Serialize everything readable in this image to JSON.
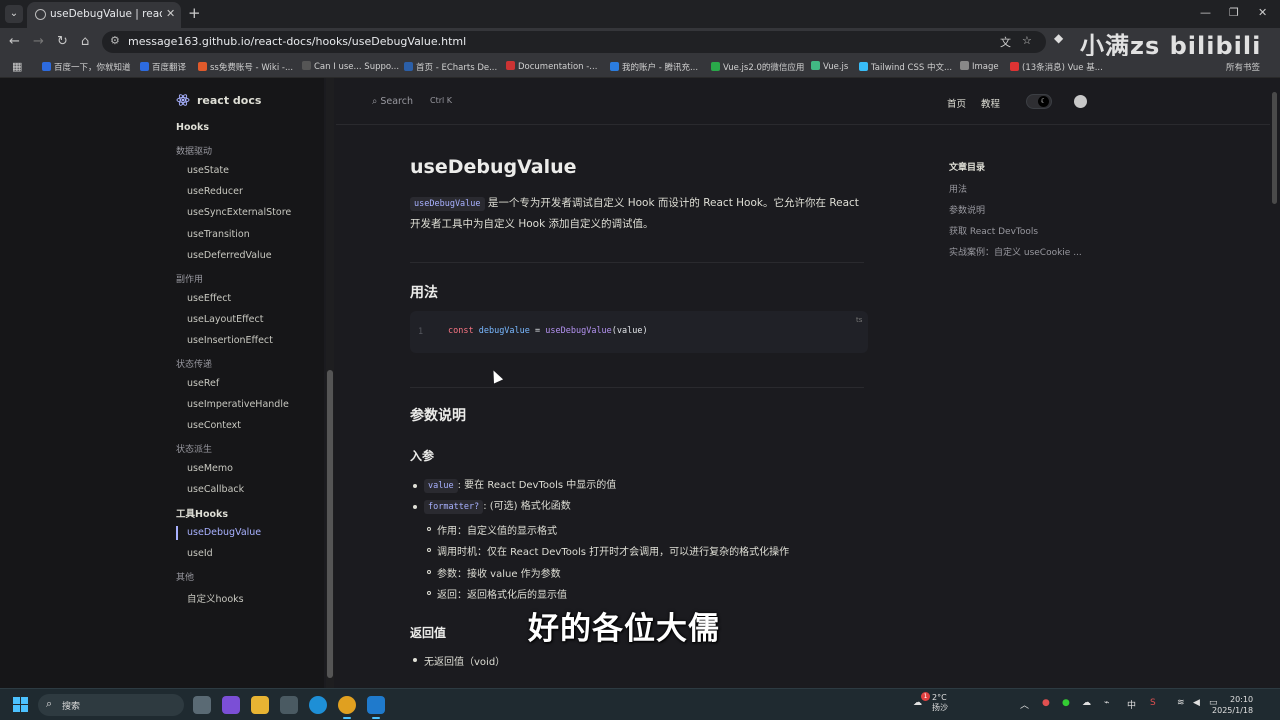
{
  "browser": {
    "tab_title": "useDebugValue | react docs",
    "url": "message163.github.io/react-docs/hooks/useDebugValue.html",
    "watermark": "小满zs bilibili",
    "bookmarks": [
      {
        "label": "百度一下，你就知道",
        "color": "#2d6bdf"
      },
      {
        "label": "百度翻译",
        "color": "#2d6bdf"
      },
      {
        "label": "ss免费账号 - Wiki -...",
        "color": "#e05a2b"
      },
      {
        "label": "Can I use... Suppo...",
        "color": "#333"
      },
      {
        "label": "首页 - ECharts De...",
        "color": "#2b5fa8"
      },
      {
        "label": "Documentation -...",
        "color": "#c33"
      },
      {
        "label": "我的账户 - 腾讯充...",
        "color": "#2b7de0"
      },
      {
        "label": "Vue.js2.0的微信应用",
        "color": "#2aa84a"
      },
      {
        "label": "Vue.js",
        "color": "#41b883"
      },
      {
        "label": "Tailwind CSS 中文...",
        "color": "#38bdf8"
      },
      {
        "label": "Image",
        "color": "#222"
      },
      {
        "label": "(13条消息) Vue 基...",
        "color": "#d33"
      }
    ],
    "bookmarks_all": "所有书签"
  },
  "sidebar": {
    "brand": "react docs",
    "groups": [
      {
        "label": "Hooks",
        "strong": true
      },
      {
        "label": "数据驱动"
      },
      {
        "item": "useState"
      },
      {
        "item": "useReducer"
      },
      {
        "item": "useSyncExternalStore"
      },
      {
        "item": "useTransition"
      },
      {
        "item": "useDeferredValue"
      },
      {
        "label": "副作用"
      },
      {
        "item": "useEffect"
      },
      {
        "item": "useLayoutEffect"
      },
      {
        "item": "useInsertionEffect"
      },
      {
        "label": "状态传递"
      },
      {
        "item": "useRef"
      },
      {
        "item": "useImperativeHandle"
      },
      {
        "item": "useContext"
      },
      {
        "label": "状态派生"
      },
      {
        "item": "useMemo"
      },
      {
        "item": "useCallback"
      },
      {
        "label": "工具Hooks",
        "strong": true
      },
      {
        "item": "useDebugValue",
        "active": true
      },
      {
        "item": "useId"
      },
      {
        "label": "其他"
      },
      {
        "item": "自定义hooks"
      }
    ]
  },
  "topnav": {
    "search": "Search",
    "search_kbd": "Ctrl K",
    "links": [
      "首页",
      "教程"
    ]
  },
  "doc": {
    "title": "useDebugValue",
    "intro_code": "useDebugValue",
    "intro_line1": " 是一个专为开发者调试自定义 Hook 而设计的 React Hook。它允许你在 React",
    "intro_line2": "开发者工具中为自定义 Hook 添加自定义的调试值。",
    "usage_heading": "用法",
    "code_line_no": "1",
    "code": {
      "kw": "const",
      "var": "debugValue",
      "eq": " = ",
      "fn": "useDebugValue",
      "args": "(value)"
    },
    "code_lang": "ts",
    "params_heading": "参数说明",
    "input_heading": "入参",
    "param1_code": "value",
    "param1_text": ": 要在 React DevTools 中显示的值",
    "param2_code": "formatter?",
    "param2_text": ": (可选) 格式化函数",
    "sub_items": [
      "作用：自定义值的显示格式",
      "调用时机：仅在 React DevTools 打开时才会调用，可以进行复杂的格式化操作",
      "参数：接收 value 作为参数",
      "返回：返回格式化后的显示值"
    ],
    "return_heading": "返回值",
    "return_item": "无返回值（void）"
  },
  "toc": {
    "title": "文章目录",
    "items": [
      "用法",
      "参数说明",
      "获取 React DevTools",
      "实战案例：自定义 useCookie ..."
    ]
  },
  "video_subtitle": "好的各位大儒",
  "taskbar": {
    "search": "搜索",
    "weather_temp": "2°C",
    "weather_desc": "扬沙",
    "weather_badge": "1",
    "ime": "中",
    "time": "20:10",
    "date": "2025/1/18"
  }
}
